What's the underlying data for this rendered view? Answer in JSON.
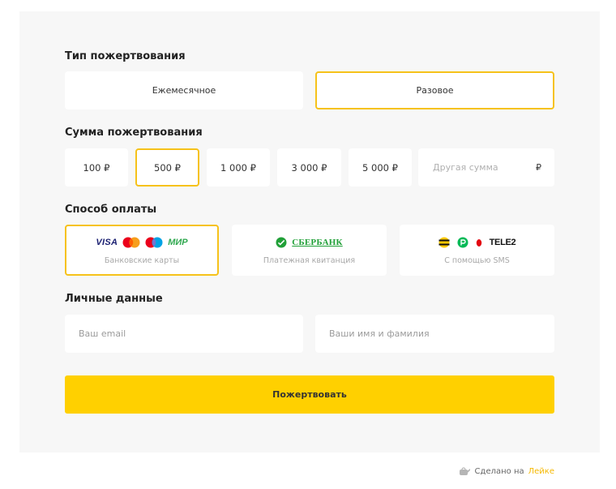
{
  "donation_type": {
    "heading": "Тип пожертвования",
    "options": [
      {
        "label": "Ежемесячное",
        "selected": false
      },
      {
        "label": "Разовое",
        "selected": true
      }
    ]
  },
  "amount": {
    "heading": "Сумма пожертвования",
    "options": [
      {
        "label": "100 ₽",
        "selected": false
      },
      {
        "label": "500 ₽",
        "selected": true
      },
      {
        "label": "1 000 ₽",
        "selected": false
      },
      {
        "label": "3 000 ₽",
        "selected": false
      },
      {
        "label": "5 000 ₽",
        "selected": false
      }
    ],
    "other_placeholder": "Другая сумма",
    "other_value": "",
    "currency": "₽"
  },
  "payment": {
    "heading": "Способ оплаты",
    "methods": [
      {
        "caption": "Банковские карты",
        "selected": true,
        "logos": {
          "visa": "VISA",
          "mir": "МИР",
          "icons": [
            "mastercard-icon",
            "maestro-icon"
          ]
        }
      },
      {
        "caption": "Платежная квитанция",
        "selected": false,
        "logos": {
          "sber": "СБЕРБАНК",
          "icons": [
            "sberbank-icon"
          ]
        }
      },
      {
        "caption": "С помощью SMS",
        "selected": false,
        "logos": {
          "tele2": "TELE2",
          "icons": [
            "beeline-icon",
            "megafon-icon",
            "mts-icon"
          ]
        }
      }
    ]
  },
  "personal": {
    "heading": "Личные данные",
    "email_placeholder": "Ваш email",
    "email_value": "",
    "name_placeholder": "Ваши имя и фамилия",
    "name_value": ""
  },
  "submit_label": "Пожертвовать",
  "footer": {
    "made_on": "Сделано на",
    "brand": "Лейке",
    "icon": "leyka-watering-can-icon"
  },
  "colors": {
    "accent": "#ffd000",
    "selected_border": "#f6c21a",
    "panel_bg": "#f7f7f7",
    "footer_link": "#f5b800"
  }
}
